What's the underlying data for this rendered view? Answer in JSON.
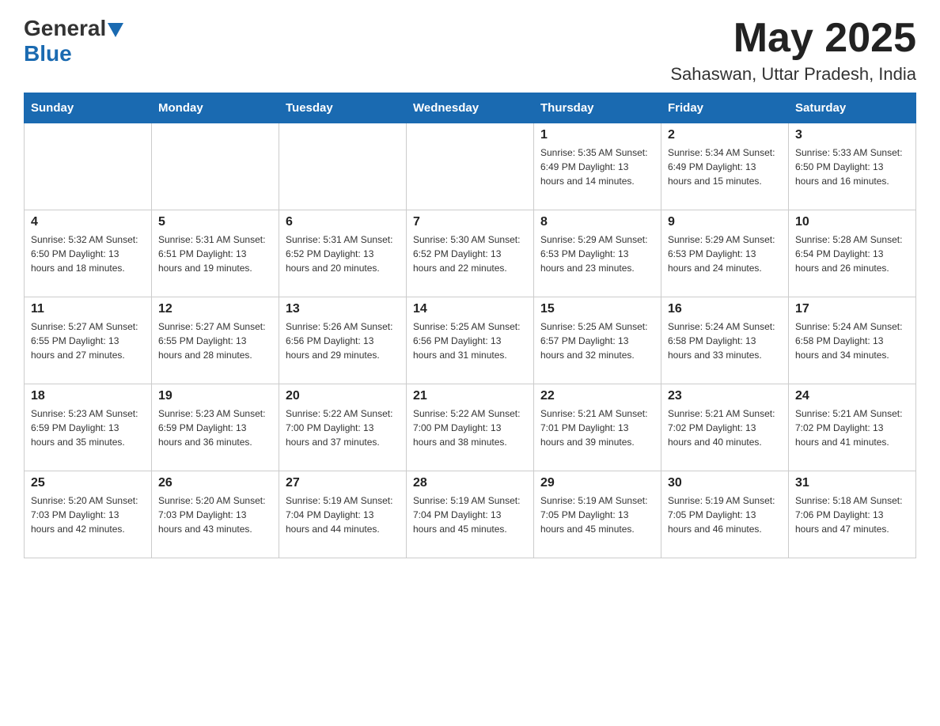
{
  "header": {
    "logo": {
      "general": "General",
      "blue": "Blue"
    },
    "month": "May 2025",
    "location": "Sahaswan, Uttar Pradesh, India"
  },
  "weekdays": [
    "Sunday",
    "Monday",
    "Tuesday",
    "Wednesday",
    "Thursday",
    "Friday",
    "Saturday"
  ],
  "weeks": [
    [
      {
        "day": "",
        "info": ""
      },
      {
        "day": "",
        "info": ""
      },
      {
        "day": "",
        "info": ""
      },
      {
        "day": "",
        "info": ""
      },
      {
        "day": "1",
        "info": "Sunrise: 5:35 AM\nSunset: 6:49 PM\nDaylight: 13 hours and 14 minutes."
      },
      {
        "day": "2",
        "info": "Sunrise: 5:34 AM\nSunset: 6:49 PM\nDaylight: 13 hours and 15 minutes."
      },
      {
        "day": "3",
        "info": "Sunrise: 5:33 AM\nSunset: 6:50 PM\nDaylight: 13 hours and 16 minutes."
      }
    ],
    [
      {
        "day": "4",
        "info": "Sunrise: 5:32 AM\nSunset: 6:50 PM\nDaylight: 13 hours and 18 minutes."
      },
      {
        "day": "5",
        "info": "Sunrise: 5:31 AM\nSunset: 6:51 PM\nDaylight: 13 hours and 19 minutes."
      },
      {
        "day": "6",
        "info": "Sunrise: 5:31 AM\nSunset: 6:52 PM\nDaylight: 13 hours and 20 minutes."
      },
      {
        "day": "7",
        "info": "Sunrise: 5:30 AM\nSunset: 6:52 PM\nDaylight: 13 hours and 22 minutes."
      },
      {
        "day": "8",
        "info": "Sunrise: 5:29 AM\nSunset: 6:53 PM\nDaylight: 13 hours and 23 minutes."
      },
      {
        "day": "9",
        "info": "Sunrise: 5:29 AM\nSunset: 6:53 PM\nDaylight: 13 hours and 24 minutes."
      },
      {
        "day": "10",
        "info": "Sunrise: 5:28 AM\nSunset: 6:54 PM\nDaylight: 13 hours and 26 minutes."
      }
    ],
    [
      {
        "day": "11",
        "info": "Sunrise: 5:27 AM\nSunset: 6:55 PM\nDaylight: 13 hours and 27 minutes."
      },
      {
        "day": "12",
        "info": "Sunrise: 5:27 AM\nSunset: 6:55 PM\nDaylight: 13 hours and 28 minutes."
      },
      {
        "day": "13",
        "info": "Sunrise: 5:26 AM\nSunset: 6:56 PM\nDaylight: 13 hours and 29 minutes."
      },
      {
        "day": "14",
        "info": "Sunrise: 5:25 AM\nSunset: 6:56 PM\nDaylight: 13 hours and 31 minutes."
      },
      {
        "day": "15",
        "info": "Sunrise: 5:25 AM\nSunset: 6:57 PM\nDaylight: 13 hours and 32 minutes."
      },
      {
        "day": "16",
        "info": "Sunrise: 5:24 AM\nSunset: 6:58 PM\nDaylight: 13 hours and 33 minutes."
      },
      {
        "day": "17",
        "info": "Sunrise: 5:24 AM\nSunset: 6:58 PM\nDaylight: 13 hours and 34 minutes."
      }
    ],
    [
      {
        "day": "18",
        "info": "Sunrise: 5:23 AM\nSunset: 6:59 PM\nDaylight: 13 hours and 35 minutes."
      },
      {
        "day": "19",
        "info": "Sunrise: 5:23 AM\nSunset: 6:59 PM\nDaylight: 13 hours and 36 minutes."
      },
      {
        "day": "20",
        "info": "Sunrise: 5:22 AM\nSunset: 7:00 PM\nDaylight: 13 hours and 37 minutes."
      },
      {
        "day": "21",
        "info": "Sunrise: 5:22 AM\nSunset: 7:00 PM\nDaylight: 13 hours and 38 minutes."
      },
      {
        "day": "22",
        "info": "Sunrise: 5:21 AM\nSunset: 7:01 PM\nDaylight: 13 hours and 39 minutes."
      },
      {
        "day": "23",
        "info": "Sunrise: 5:21 AM\nSunset: 7:02 PM\nDaylight: 13 hours and 40 minutes."
      },
      {
        "day": "24",
        "info": "Sunrise: 5:21 AM\nSunset: 7:02 PM\nDaylight: 13 hours and 41 minutes."
      }
    ],
    [
      {
        "day": "25",
        "info": "Sunrise: 5:20 AM\nSunset: 7:03 PM\nDaylight: 13 hours and 42 minutes."
      },
      {
        "day": "26",
        "info": "Sunrise: 5:20 AM\nSunset: 7:03 PM\nDaylight: 13 hours and 43 minutes."
      },
      {
        "day": "27",
        "info": "Sunrise: 5:19 AM\nSunset: 7:04 PM\nDaylight: 13 hours and 44 minutes."
      },
      {
        "day": "28",
        "info": "Sunrise: 5:19 AM\nSunset: 7:04 PM\nDaylight: 13 hours and 45 minutes."
      },
      {
        "day": "29",
        "info": "Sunrise: 5:19 AM\nSunset: 7:05 PM\nDaylight: 13 hours and 45 minutes."
      },
      {
        "day": "30",
        "info": "Sunrise: 5:19 AM\nSunset: 7:05 PM\nDaylight: 13 hours and 46 minutes."
      },
      {
        "day": "31",
        "info": "Sunrise: 5:18 AM\nSunset: 7:06 PM\nDaylight: 13 hours and 47 minutes."
      }
    ]
  ]
}
